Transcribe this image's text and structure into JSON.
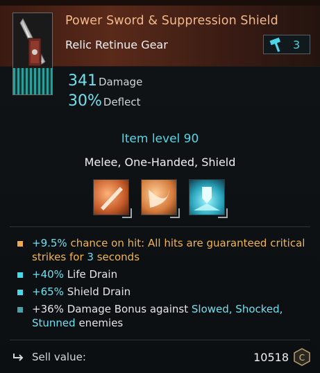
{
  "header": {
    "title": "Power Sword & Suppression Shield",
    "subtitle": "Relic Retinue Gear",
    "level_badge": {
      "icon": "hammer-icon",
      "value": "3"
    }
  },
  "stats": [
    {
      "value": "341",
      "label": "Damage"
    },
    {
      "value": "30%",
      "label": "Deflect"
    }
  ],
  "item_level": "Item level 90",
  "tags": "Melee, One-Handed, Shield",
  "skills": [
    {
      "icon": "blade-slash-icon"
    },
    {
      "icon": "crescent-sweep-icon"
    },
    {
      "icon": "shield-burst-icon"
    }
  ],
  "modifiers": [
    {
      "pre": "+9.5%",
      "text1": " chance on hit: All hits are guaranteed critical strikes for ",
      "hi2": "3",
      "text2": " seconds",
      "color": "#f2b64a"
    },
    {
      "pre": "+40%",
      "text1": " Life Drain"
    },
    {
      "pre": "+65%",
      "text1": " Shield Drain"
    },
    {
      "pre": "+36%",
      "text1": " Damage Bonus against ",
      "c1": "Slowed, Shocked,",
      "c2": "Stunned",
      "text2": " enemies"
    }
  ],
  "sell": {
    "label": "Sell value:",
    "amount": "10518"
  },
  "colors": {
    "accent": "#43d6e6",
    "title": "#f2b98a",
    "gold": "#f2b64a"
  }
}
